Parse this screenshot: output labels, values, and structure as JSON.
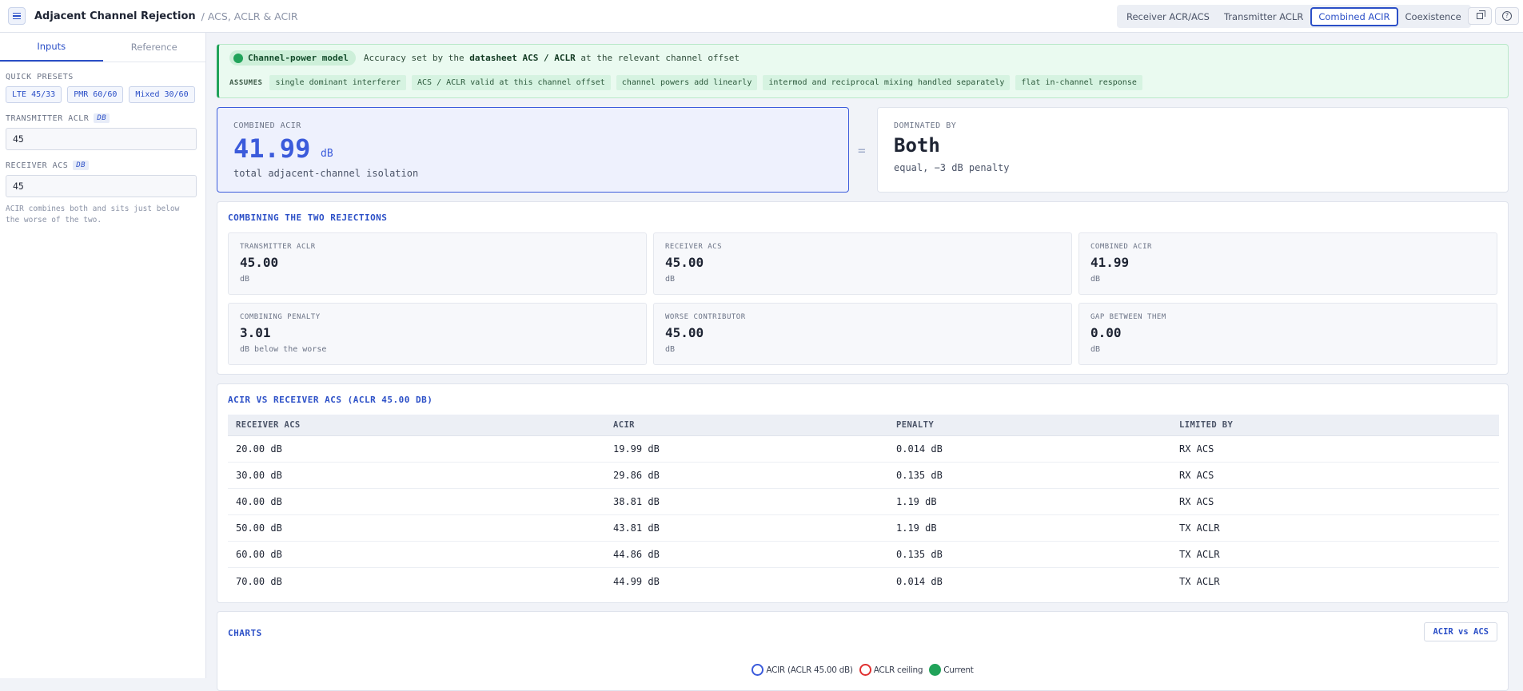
{
  "header": {
    "title": "Adjacent Channel Rejection",
    "subtitle": "/ ACS, ACLR & ACIR",
    "tabs": [
      {
        "label": "Receiver ACR/ACS"
      },
      {
        "label": "Transmitter ACLR"
      },
      {
        "label": "Combined ACIR",
        "active": true
      },
      {
        "label": "Coexistence"
      }
    ],
    "icons": [
      "menu-icon",
      "copy-icon",
      "help-icon"
    ]
  },
  "sidebar": {
    "tabs": [
      {
        "label": "Inputs",
        "active": true
      },
      {
        "label": "Reference"
      }
    ],
    "presets_label": "QUICK PRESETS",
    "presets": [
      "LTE 45/33",
      "PMR 60/60",
      "Mixed 30/60"
    ],
    "tx_label": "TRANSMITTER ACLR",
    "tx_unit": "DB",
    "tx_value": "45",
    "rx_label": "RECEIVER ACS",
    "rx_unit": "DB",
    "rx_value": "45",
    "note": "ACIR combines both and sits just below the worse of the two."
  },
  "banner": {
    "model": "Channel-power model",
    "text_pre": "Accuracy set by the ",
    "text_bold": "datasheet ACS / ACLR",
    "text_post": " at the relevant channel offset",
    "assumes_label": "ASSUMES",
    "assumptions": [
      "single dominant interferer",
      "ACS / ACLR valid at this channel offset",
      "channel powers add linearly",
      "intermod and reciprocal mixing handled separately",
      "flat in-channel response"
    ],
    "accent": "#21a35a"
  },
  "result": {
    "label": "COMBINED ACIR",
    "value": "41.99",
    "unit": "dB",
    "desc": "total adjacent-channel isolation",
    "equals": "=",
    "dominated_label": "DOMINATED BY",
    "dominated_value": "Both",
    "dominated_desc": "equal, −3 dB penalty"
  },
  "combining": {
    "title": "COMBINING THE TWO REJECTIONS",
    "metrics": [
      {
        "label": "TRANSMITTER ACLR",
        "value": "45.00",
        "unit": "dB"
      },
      {
        "label": "RECEIVER ACS",
        "value": "45.00",
        "unit": "dB"
      },
      {
        "label": "COMBINED ACIR",
        "value": "41.99",
        "unit": "dB"
      },
      {
        "label": "COMBINING PENALTY",
        "value": "3.01",
        "unit": "dB below the worse"
      },
      {
        "label": "WORSE CONTRIBUTOR",
        "value": "45.00",
        "unit": "dB"
      },
      {
        "label": "GAP BETWEEN THEM",
        "value": "0.00",
        "unit": "dB"
      }
    ]
  },
  "table": {
    "title": "ACIR VS RECEIVER ACS (ACLR 45.00 DB)",
    "columns": [
      "RECEIVER ACS",
      "ACIR",
      "PENALTY",
      "LIMITED BY"
    ],
    "rows": [
      [
        "20.00 dB",
        "19.99 dB",
        "0.014 dB",
        "RX ACS"
      ],
      [
        "30.00 dB",
        "29.86 dB",
        "0.135 dB",
        "RX ACS"
      ],
      [
        "40.00 dB",
        "38.81 dB",
        "1.19 dB",
        "RX ACS"
      ],
      [
        "50.00 dB",
        "43.81 dB",
        "1.19 dB",
        "TX ACLR"
      ],
      [
        "60.00 dB",
        "44.86 dB",
        "0.135 dB",
        "TX ACLR"
      ],
      [
        "70.00 dB",
        "44.99 dB",
        "0.014 dB",
        "TX ACLR"
      ]
    ]
  },
  "charts": {
    "title": "CHARTS",
    "button": "ACIR vs ACS",
    "legend": [
      {
        "label": "ACIR (ACLR 45.00 dB)",
        "color": "#3b5bdb",
        "style": "ring"
      },
      {
        "label": "ACLR ceiling",
        "color": "#e03131",
        "style": "ring"
      },
      {
        "label": "Current",
        "color": "#21a35a",
        "style": "filled"
      }
    ]
  },
  "colors": {
    "accent": "#2b4fc7",
    "acir": "#3b5bdb",
    "ok": "#21a35a"
  }
}
